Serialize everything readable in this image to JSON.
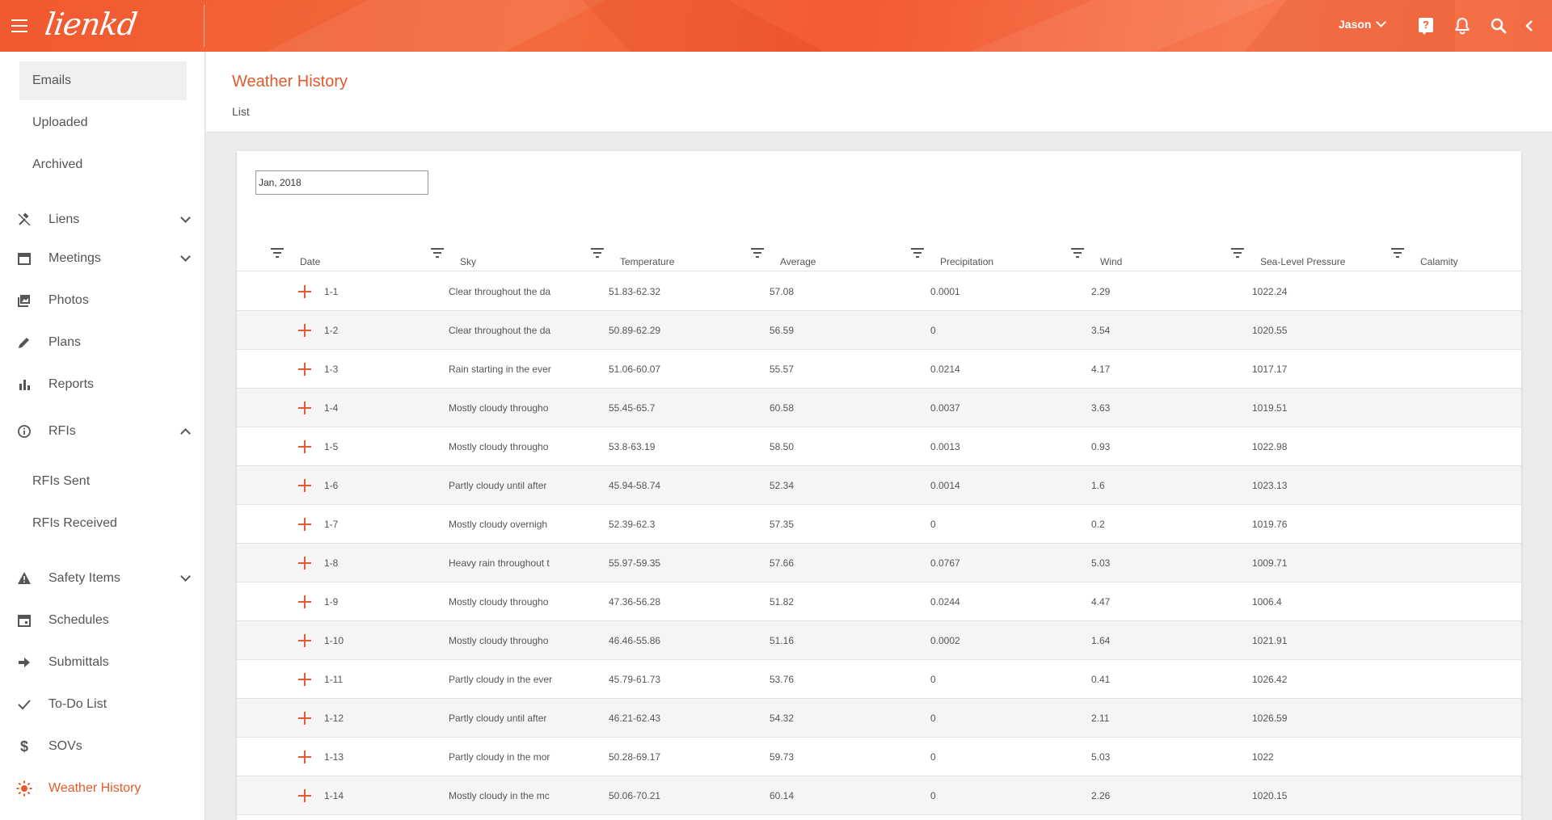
{
  "app": {
    "logo_text": "lienkd",
    "user_name": "Jason"
  },
  "icons": {
    "help": "help-icon",
    "bell": "bell-icon",
    "search": "search-icon",
    "back": "chevron-left-icon",
    "menu": "hamburger-icon"
  },
  "colors": {
    "accent": "#e65a2c",
    "topbar": "#f25a34"
  },
  "sidebar": {
    "sub_top": [
      "Emails",
      "Uploaded",
      "Archived"
    ],
    "items": [
      {
        "label": "Liens",
        "icon": "gavel-icon"
      },
      {
        "label": "Meetings",
        "icon": "calendar-icon"
      },
      {
        "label": "Photos",
        "icon": "photos-icon"
      },
      {
        "label": "Plans",
        "icon": "pencil-icon"
      },
      {
        "label": "Reports",
        "icon": "bar-chart-icon"
      },
      {
        "label": "RFIs",
        "icon": "info-icon"
      },
      {
        "label": "Safety Items",
        "icon": "warning-icon"
      },
      {
        "label": "Schedules",
        "icon": "calendar-event-icon"
      },
      {
        "label": "Submittals",
        "icon": "arrow-right-icon"
      },
      {
        "label": "To-Do List",
        "icon": "checkmark-icon"
      },
      {
        "label": "SOVs",
        "icon": "dollar-icon"
      },
      {
        "label": "Weather History",
        "icon": "sun-icon"
      }
    ],
    "rfi_sub": [
      "RFIs Sent",
      "RFIs Received"
    ]
  },
  "page": {
    "title": "Weather History",
    "subtitle": "List"
  },
  "filter": {
    "month_value": "Jan, 2018"
  },
  "table": {
    "columns": [
      "Date",
      "Sky",
      "Temperature",
      "Average",
      "Precipitation",
      "Wind",
      "Sea-Level Pressure",
      "Calamity"
    ],
    "rows": [
      [
        "1-1",
        "Clear throughout the da",
        "51.83-62.32",
        "57.08",
        "0.0001",
        "2.29",
        "1022.24",
        ""
      ],
      [
        "1-2",
        "Clear throughout the da",
        "50.89-62.29",
        "56.59",
        "0",
        "3.54",
        "1020.55",
        ""
      ],
      [
        "1-3",
        "Rain starting in the ever",
        "51.06-60.07",
        "55.57",
        "0.0214",
        "4.17",
        "1017.17",
        ""
      ],
      [
        "1-4",
        "Mostly cloudy througho",
        "55.45-65.7",
        "60.58",
        "0.0037",
        "3.63",
        "1019.51",
        ""
      ],
      [
        "1-5",
        "Mostly cloudy througho",
        "53.8-63.19",
        "58.50",
        "0.0013",
        "0.93",
        "1022.98",
        ""
      ],
      [
        "1-6",
        "Partly cloudy until after",
        "45.94-58.74",
        "52.34",
        "0.0014",
        "1.6",
        "1023.13",
        ""
      ],
      [
        "1-7",
        "Mostly cloudy overnigh",
        "52.39-62.3",
        "57.35",
        "0",
        "0.2",
        "1019.76",
        ""
      ],
      [
        "1-8",
        "Heavy rain throughout t",
        "55.97-59.35",
        "57.66",
        "0.0767",
        "5.03",
        "1009.71",
        ""
      ],
      [
        "1-9",
        "Mostly cloudy througho",
        "47.36-56.28",
        "51.82",
        "0.0244",
        "4.47",
        "1006.4",
        ""
      ],
      [
        "1-10",
        "Mostly cloudy througho",
        "46.46-55.86",
        "51.16",
        "0.0002",
        "1.64",
        "1021.91",
        ""
      ],
      [
        "1-11",
        "Partly cloudy in the ever",
        "45.79-61.73",
        "53.76",
        "0",
        "0.41",
        "1026.42",
        ""
      ],
      [
        "1-12",
        "Partly cloudy until after",
        "46.21-62.43",
        "54.32",
        "0",
        "2.11",
        "1026.59",
        ""
      ],
      [
        "1-13",
        "Partly cloudy in the mor",
        "50.28-69.17",
        "59.73",
        "0",
        "5.03",
        "1022",
        ""
      ],
      [
        "1-14",
        "Mostly cloudy in the mc",
        "50.06-70.21",
        "60.14",
        "0",
        "2.26",
        "1020.15",
        ""
      ]
    ]
  }
}
